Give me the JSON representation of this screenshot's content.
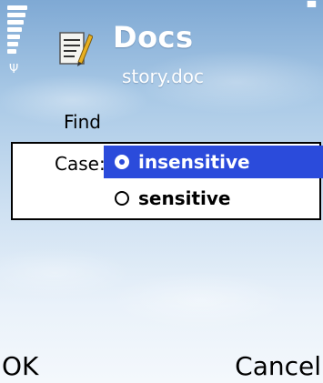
{
  "app": {
    "title": "Docs",
    "document_name": "story.doc"
  },
  "status": {
    "signal_icon": "signal-strength-icon",
    "antenna_icon": "antenna-icon",
    "battery_icon": "battery-icon"
  },
  "form": {
    "find_label": "Find",
    "case_label": "Case:",
    "options": [
      {
        "label": "insensitive",
        "selected": true
      },
      {
        "label": "sensitive",
        "selected": false
      }
    ]
  },
  "softkeys": {
    "left": "OK",
    "right": "Cancel"
  },
  "colors": {
    "selection": "#2b4bdb",
    "title_text": "#ffffff"
  }
}
